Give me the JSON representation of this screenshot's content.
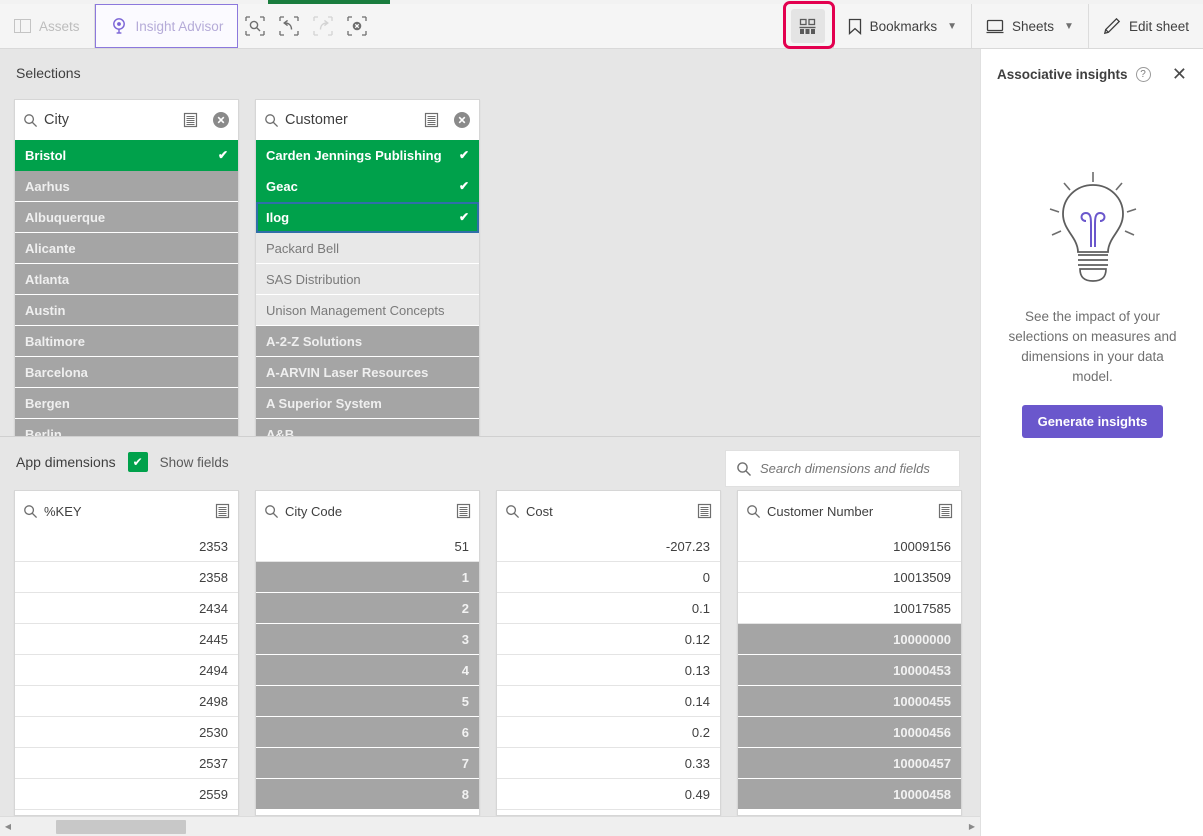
{
  "toolbar": {
    "assets_label": "Assets",
    "insight_advisor_label": "Insight Advisor",
    "selection_search_icon": "selection-search-icon",
    "step_back_icon": "step-back-icon",
    "step_forward_icon": "step-forward-icon",
    "clear_all_icon": "clear-all-selections-icon",
    "selections_tool_icon": "selections-tool-icon",
    "bookmarks_label": "Bookmarks",
    "sheets_label": "Sheets",
    "edit_sheet_label": "Edit sheet",
    "highlight_color": "#e3004f",
    "progress_color": "#1a7d3e"
  },
  "selections": {
    "title": "Selections",
    "listboxes": [
      {
        "title": "City",
        "rows": [
          {
            "label": "Bristol",
            "state": "selected"
          },
          {
            "label": "Aarhus",
            "state": "excluded"
          },
          {
            "label": "Albuquerque",
            "state": "excluded"
          },
          {
            "label": "Alicante",
            "state": "excluded"
          },
          {
            "label": "Atlanta",
            "state": "excluded"
          },
          {
            "label": "Austin",
            "state": "excluded"
          },
          {
            "label": "Baltimore",
            "state": "excluded"
          },
          {
            "label": "Barcelona",
            "state": "excluded"
          },
          {
            "label": "Bergen",
            "state": "excluded"
          },
          {
            "label": "Berlin",
            "state": "excluded"
          }
        ]
      },
      {
        "title": "Customer",
        "rows": [
          {
            "label": "Carden Jennings Publishing",
            "state": "selected"
          },
          {
            "label": "Geac",
            "state": "selected"
          },
          {
            "label": "Ilog",
            "state": "selected",
            "focus": true
          },
          {
            "label": "Packard Bell",
            "state": "alternative"
          },
          {
            "label": "SAS Distribution",
            "state": "alternative"
          },
          {
            "label": "Unison Management Concepts",
            "state": "alternative"
          },
          {
            "label": "A-2-Z Solutions",
            "state": "excluded"
          },
          {
            "label": "A-ARVIN Laser Resources",
            "state": "excluded"
          },
          {
            "label": "A Superior System",
            "state": "excluded"
          },
          {
            "label": "A&B",
            "state": "excluded"
          }
        ]
      }
    ]
  },
  "dimensions": {
    "label": "App dimensions",
    "show_fields_label": "Show fields",
    "show_fields_checked": true,
    "search_placeholder": "Search dimensions and fields",
    "search_value": "",
    "listboxes": [
      {
        "title": "%KEY",
        "rows": [
          {
            "label": "2353",
            "state": "optional"
          },
          {
            "label": "2358",
            "state": "optional"
          },
          {
            "label": "2434",
            "state": "optional"
          },
          {
            "label": "2445",
            "state": "optional"
          },
          {
            "label": "2494",
            "state": "optional"
          },
          {
            "label": "2498",
            "state": "optional"
          },
          {
            "label": "2530",
            "state": "optional"
          },
          {
            "label": "2537",
            "state": "optional"
          },
          {
            "label": "2559",
            "state": "optional"
          }
        ]
      },
      {
        "title": "City Code",
        "rows": [
          {
            "label": "51",
            "state": "optional"
          },
          {
            "label": "1",
            "state": "excluded"
          },
          {
            "label": "2",
            "state": "excluded"
          },
          {
            "label": "3",
            "state": "excluded"
          },
          {
            "label": "4",
            "state": "excluded"
          },
          {
            "label": "5",
            "state": "excluded"
          },
          {
            "label": "6",
            "state": "excluded"
          },
          {
            "label": "7",
            "state": "excluded"
          },
          {
            "label": "8",
            "state": "excluded"
          }
        ]
      },
      {
        "title": "Cost",
        "rows": [
          {
            "label": "-207.23",
            "state": "optional"
          },
          {
            "label": "0",
            "state": "optional"
          },
          {
            "label": "0.1",
            "state": "optional"
          },
          {
            "label": "0.12",
            "state": "optional"
          },
          {
            "label": "0.13",
            "state": "optional"
          },
          {
            "label": "0.14",
            "state": "optional"
          },
          {
            "label": "0.2",
            "state": "optional"
          },
          {
            "label": "0.33",
            "state": "optional"
          },
          {
            "label": "0.49",
            "state": "optional"
          }
        ]
      },
      {
        "title": "Customer Number",
        "rows": [
          {
            "label": "10009156",
            "state": "optional"
          },
          {
            "label": "10013509",
            "state": "optional"
          },
          {
            "label": "10017585",
            "state": "optional"
          },
          {
            "label": "10000000",
            "state": "excluded"
          },
          {
            "label": "10000453",
            "state": "excluded"
          },
          {
            "label": "10000455",
            "state": "excluded"
          },
          {
            "label": "10000456",
            "state": "excluded"
          },
          {
            "label": "10000457",
            "state": "excluded"
          },
          {
            "label": "10000458",
            "state": "excluded"
          }
        ]
      }
    ]
  },
  "insights": {
    "title": "Associative insights",
    "help_glyph": "?",
    "close_glyph": "✕",
    "description": "See the impact of your selections on measures and dimensions in your data model.",
    "button_label": "Generate insights",
    "button_color": "#6a57cc",
    "bulb_accent_color": "#6a57cc"
  }
}
